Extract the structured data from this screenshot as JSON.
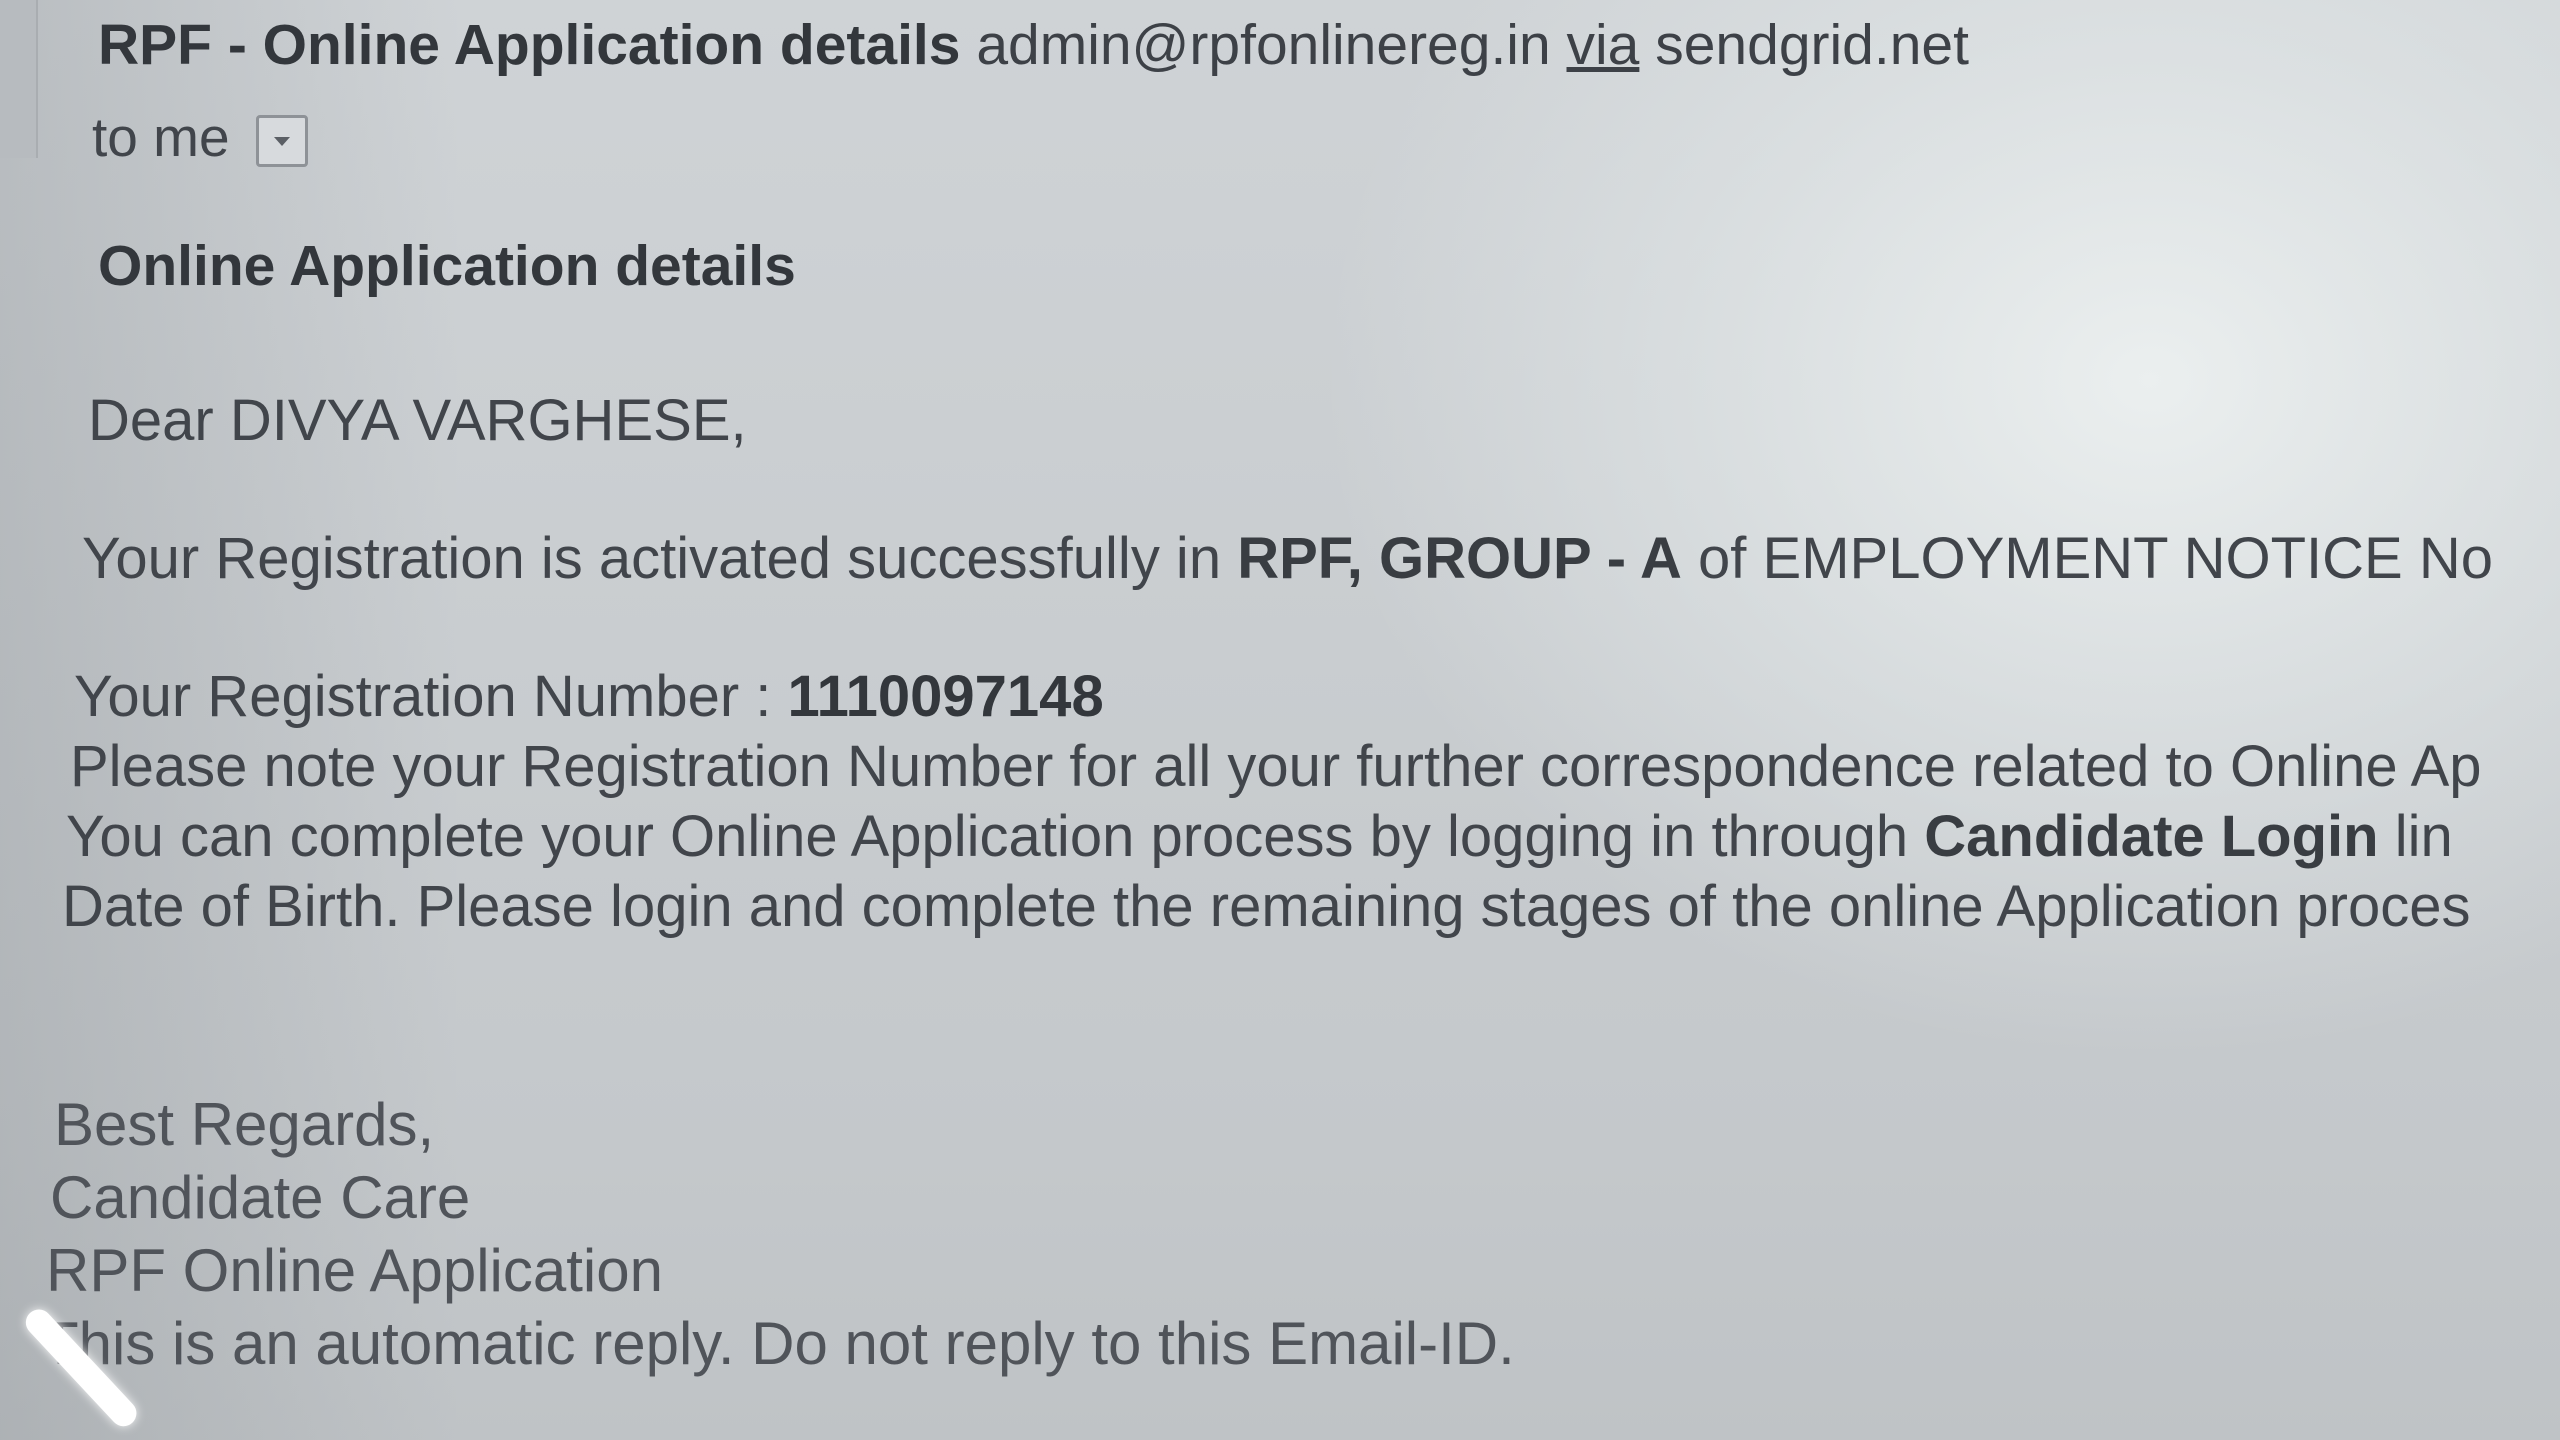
{
  "email": {
    "subject": "RPF - Online Application details",
    "sender": "admin@rpfonlinereg.in",
    "via_label": "via",
    "via_domain": "sendgrid.net",
    "recipient": "to me",
    "heading": "Online Application details",
    "greeting": "Dear DIVYA VARGHESE,",
    "activated": {
      "prefix": "Your Registration is activated successfully in ",
      "highlight": "RPF, GROUP - A",
      "suffix": " of EMPLOYMENT NOTICE No"
    },
    "registration": {
      "label": "Your Registration Number : ",
      "number": "1110097148"
    },
    "note_line": "Please note your Registration Number for all your further correspondence related to Online Ap",
    "complete_line": {
      "prefix": "You can complete your Online Application process by logging in through ",
      "link_text": "Candidate Login",
      "suffix": " lin"
    },
    "dob_line": "Date of Birth. Please login and complete the remaining stages of the online Application proces",
    "signature": {
      "line1": "Best Regards,",
      "line2": "Candidate Care",
      "line3": "RPF Online Application",
      "line4": "This is an automatic reply. Do not reply to this Email-ID."
    }
  },
  "icons": {
    "dropdown": "chevron-down-icon"
  }
}
